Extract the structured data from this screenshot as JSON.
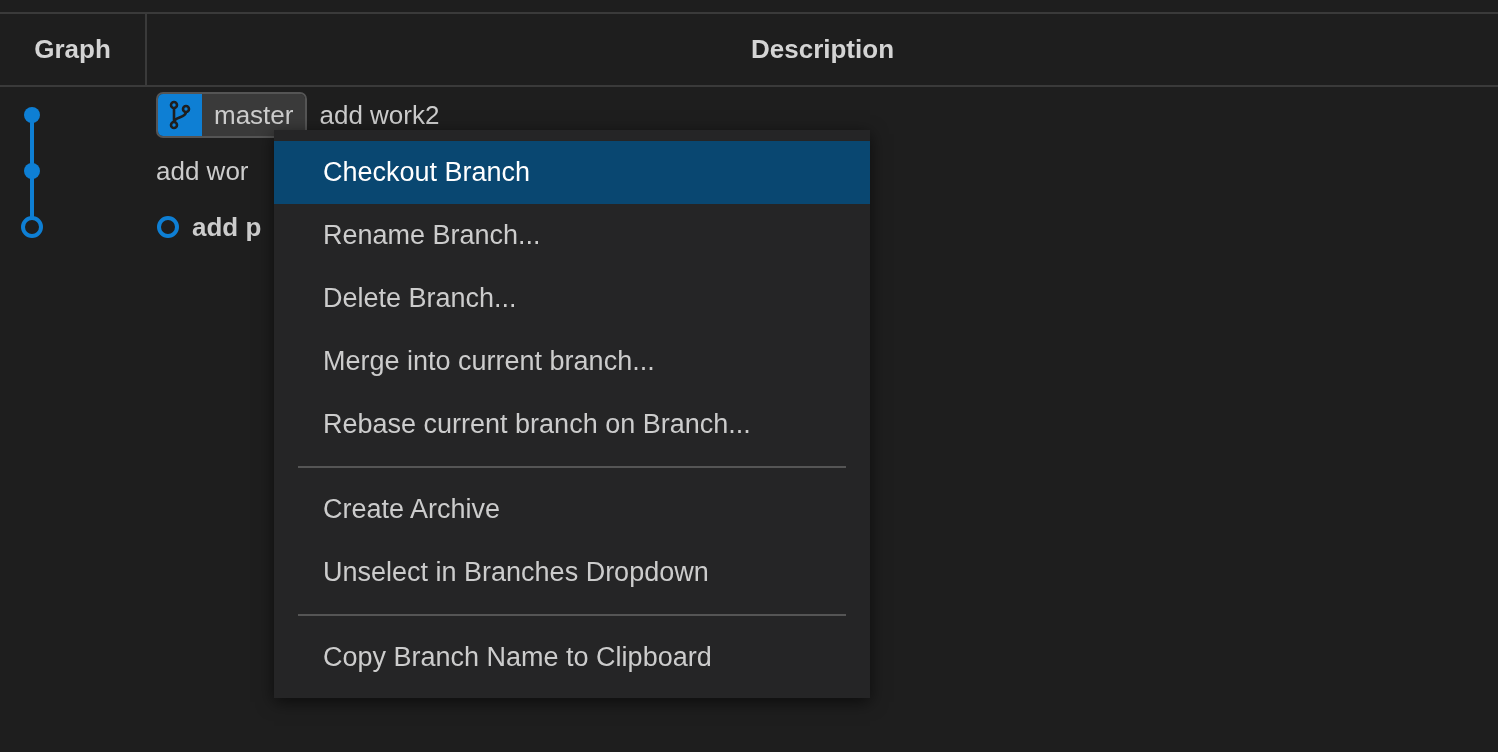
{
  "columns": [
    "Graph",
    "Description"
  ],
  "commits": [
    {
      "kind": "commit",
      "branch": "master",
      "message": "add work2"
    },
    {
      "kind": "commit",
      "message": "add wor"
    },
    {
      "kind": "uncommitted",
      "message": "add p"
    }
  ],
  "context_menu": {
    "sections": [
      [
        {
          "label": "Checkout Branch",
          "selected": true
        },
        {
          "label": "Rename Branch...",
          "selected": false
        },
        {
          "label": "Delete Branch...",
          "selected": false
        },
        {
          "label": "Merge into current branch...",
          "selected": false
        },
        {
          "label": "Rebase current branch on Branch...",
          "selected": false
        }
      ],
      [
        {
          "label": "Create Archive",
          "selected": false
        },
        {
          "label": "Unselect in Branches Dropdown",
          "selected": false
        }
      ],
      [
        {
          "label": "Copy Branch Name to Clipboard",
          "selected": false
        }
      ]
    ]
  }
}
